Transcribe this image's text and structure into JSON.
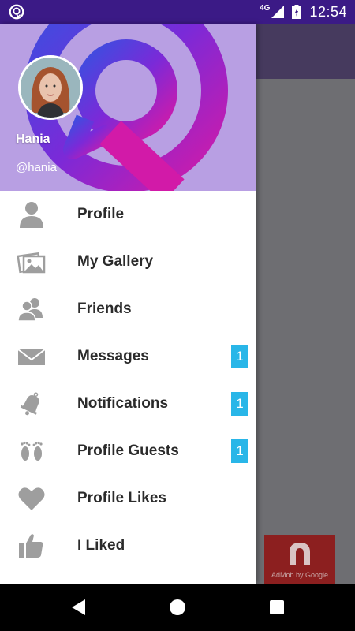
{
  "status_bar": {
    "network": "4G",
    "time": "12:54"
  },
  "drawer": {
    "user": {
      "name": "Hania",
      "handle": "@hania"
    },
    "menu": [
      {
        "label": "Profile",
        "icon": "person-icon",
        "badge": ""
      },
      {
        "label": "My Gallery",
        "icon": "gallery-icon",
        "badge": ""
      },
      {
        "label": "Friends",
        "icon": "friends-icon",
        "badge": ""
      },
      {
        "label": "Messages",
        "icon": "envelope-icon",
        "badge": "1"
      },
      {
        "label": "Notifications",
        "icon": "bell-icon",
        "badge": "1"
      },
      {
        "label": "Profile Guests",
        "icon": "footprints-icon",
        "badge": "1"
      },
      {
        "label": "Profile Likes",
        "icon": "heart-icon",
        "badge": ""
      },
      {
        "label": "I Liked",
        "icon": "thumbs-up-icon",
        "badge": ""
      }
    ]
  },
  "ad": {
    "label": "AdMob by Google"
  },
  "colors": {
    "status_bar": "#3b1a86",
    "badge": "#29b6e8",
    "header_bg": "#b89fe3",
    "icon_gray": "#9e9e9e"
  }
}
